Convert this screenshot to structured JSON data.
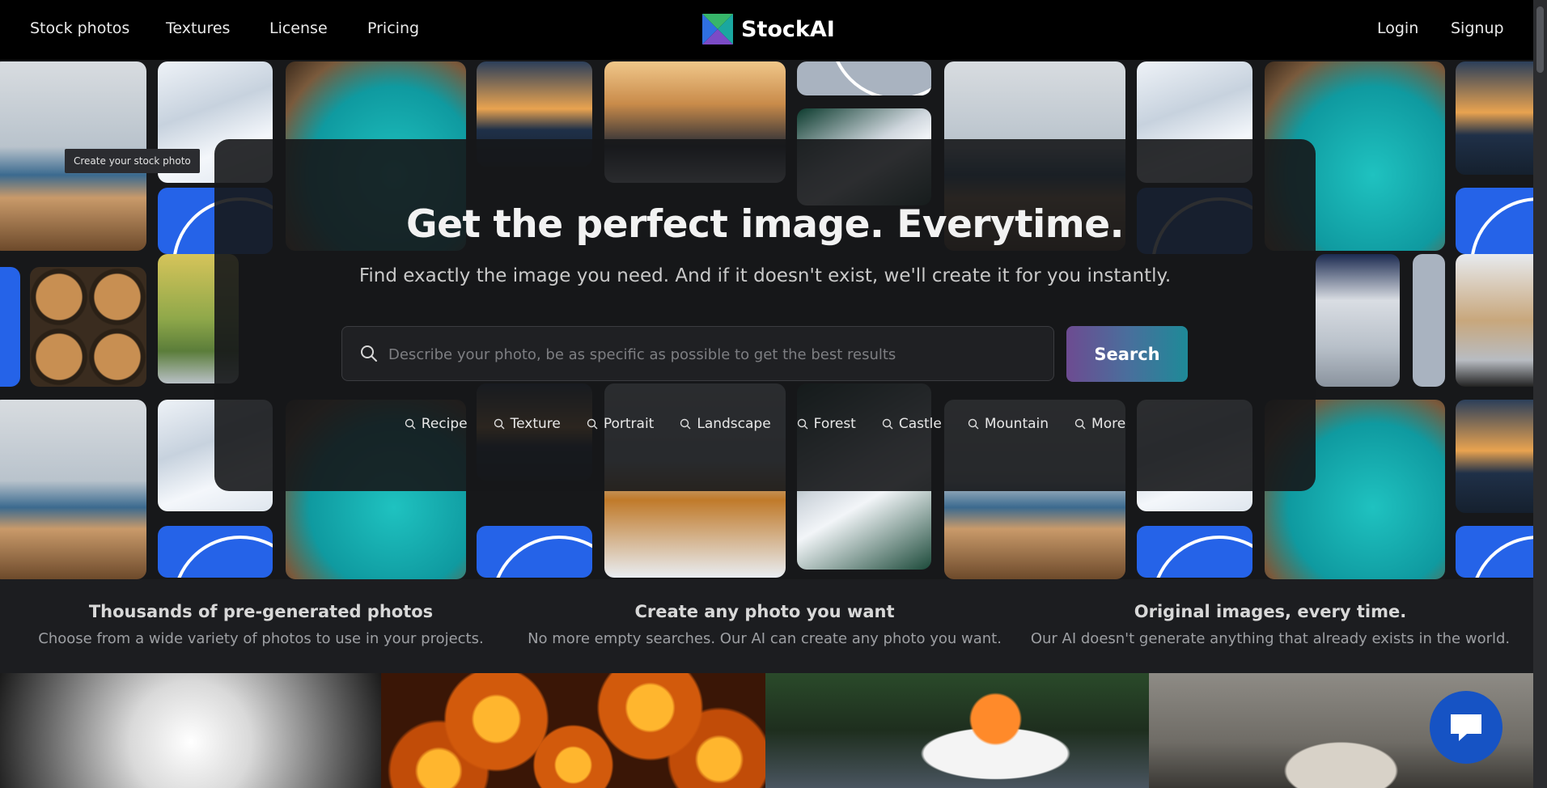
{
  "nav": {
    "links_left": [
      "Stock photos",
      "Textures",
      "License",
      "Pricing"
    ],
    "brand": "StockAI",
    "login": "Login",
    "signup": "Signup"
  },
  "tooltip": "Create your stock photo",
  "hero": {
    "title": "Get the perfect image. Everytime.",
    "subtitle": "Find exactly the image you need. And if it doesn't exist, we'll create it for you instantly.",
    "search_placeholder": "Describe your photo, be as specific as possible to get the best results",
    "search_button": "Search",
    "chips": [
      "Recipe",
      "Texture",
      "Portrait",
      "Landscape",
      "Forest",
      "Castle",
      "Mountain",
      "More"
    ]
  },
  "features": [
    {
      "title": "Thousands of pre-generated photos",
      "desc": "Choose from a wide variety of photos to use in your projects."
    },
    {
      "title": "Create any photo you want",
      "desc": "No more empty searches. Our AI can create any photo you want."
    },
    {
      "title": "Original images, every time.",
      "desc": "Our AI doesn't generate anything that already exists in the world."
    }
  ],
  "icons": {
    "search": "search-icon",
    "chat": "chat-icon",
    "logo": "logo-icon"
  },
  "colors": {
    "search_button_gradient": [
      "#6d4b91",
      "#1e8a98"
    ],
    "chat_button": "#1653c4",
    "nav_background": "#000000"
  }
}
